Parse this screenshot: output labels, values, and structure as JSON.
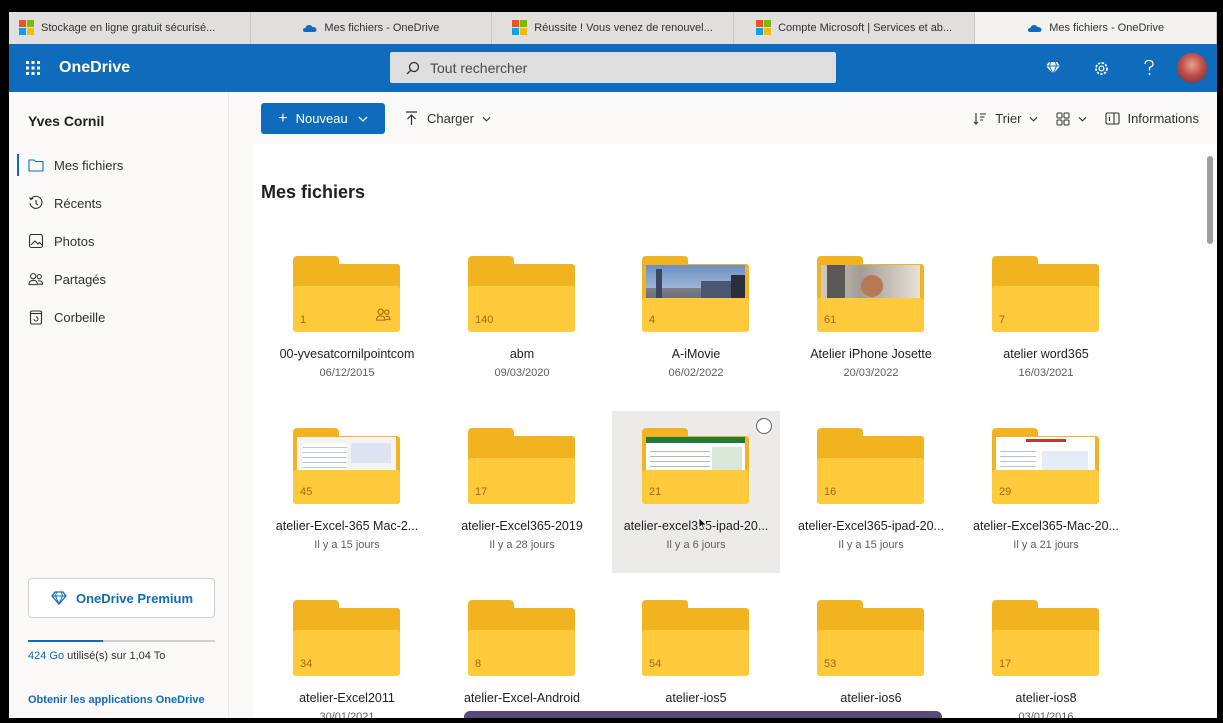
{
  "tabs": [
    {
      "label": "Stockage en ligne gratuit sécurisé...",
      "icon": "microsoft-logo"
    },
    {
      "label": "Mes fichiers - OneDrive",
      "icon": "onedrive-cloud-icon"
    },
    {
      "label": "Réussite ! Vous venez de renouvel...",
      "icon": "microsoft-logo"
    },
    {
      "label": "Compte Microsoft | Services et ab...",
      "icon": "microsoft-logo"
    },
    {
      "label": "Mes fichiers - OneDrive",
      "icon": "onedrive-cloud-icon"
    }
  ],
  "header": {
    "brand": "OneDrive",
    "search_placeholder": "Tout rechercher"
  },
  "sidebar": {
    "user": "Yves Cornil",
    "items": [
      {
        "label": "Mes fichiers",
        "icon": "folder-icon"
      },
      {
        "label": "Récents",
        "icon": "history-icon"
      },
      {
        "label": "Photos",
        "icon": "image-icon"
      },
      {
        "label": "Partagés",
        "icon": "people-icon"
      },
      {
        "label": "Corbeille",
        "icon": "recycle-bin-icon"
      }
    ],
    "premium": "OneDrive Premium",
    "storage_used": "424 Go",
    "storage_rest": " utilisé(s) sur 1,04 To",
    "storage_fraction": 0.4,
    "get_apps": "Obtenir les applications OneDrive"
  },
  "commands": {
    "new": "Nouveau",
    "upload": "Charger",
    "sort": "Trier",
    "info": "Informations"
  },
  "page_title": "Mes fichiers",
  "folders": [
    {
      "name": "00-yvesatcornilpointcom",
      "date": "06/12/2015",
      "count": "1",
      "shared": true
    },
    {
      "name": "abm",
      "date": "09/03/2020",
      "count": "140"
    },
    {
      "name": "A-iMovie",
      "date": "06/02/2022",
      "count": "4",
      "thumb": "city"
    },
    {
      "name": "Atelier iPhone Josette",
      "date": "20/03/2022",
      "count": "61",
      "thumb": "photo"
    },
    {
      "name": "atelier word365",
      "date": "16/03/2021",
      "count": "7"
    },
    {
      "name": "atelier-Excel-365 Mac-2...",
      "date": "Il y a 15 jours",
      "count": "45",
      "thumb": "sheet"
    },
    {
      "name": "atelier-Excel365-2019",
      "date": "Il y a 28 jours",
      "count": "17"
    },
    {
      "name": "atelier-excel365-ipad-20...",
      "date": "Il y a 6 jours",
      "count": "21",
      "thumb": "excel"
    },
    {
      "name": "atelier-Excel365-ipad-20...",
      "date": "Il y a 15 jours",
      "count": "16"
    },
    {
      "name": "atelier-Excel365-Mac-20...",
      "date": "Il y a 21 jours",
      "count": "29",
      "thumb": "slide"
    },
    {
      "name": "atelier-Excel2011",
      "date": "30/01/2021",
      "count": "34"
    },
    {
      "name": "atelier-Excel-Android",
      "date": "",
      "count": "8"
    },
    {
      "name": "atelier-ios5",
      "date": "",
      "count": "54"
    },
    {
      "name": "atelier-ios6",
      "date": "",
      "count": "53"
    },
    {
      "name": "atelier-ios8",
      "date": "03/01/2016",
      "count": "17"
    }
  ]
}
